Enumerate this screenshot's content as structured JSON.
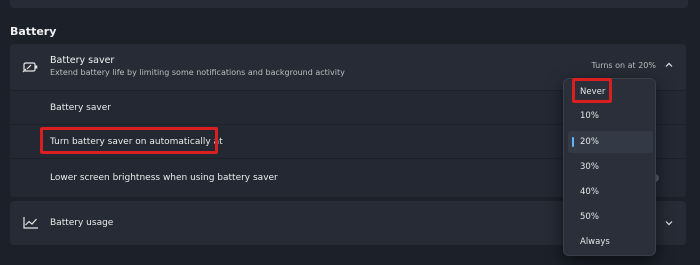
{
  "section": {
    "title": "Battery"
  },
  "battery_saver": {
    "title": "Battery saver",
    "subtitle": "Extend battery life by limiting some notifications and background activity",
    "status": "Turns on at 20%"
  },
  "rows": {
    "battery_saver_label": "Battery saver",
    "auto_on_label": "Turn battery saver on automatically at",
    "brightness_label": "Lower screen brightness when using battery saver"
  },
  "battery_usage": {
    "label": "Battery usage"
  },
  "dropdown": {
    "options": [
      "Never",
      "10%",
      "20%",
      "30%",
      "40%",
      "50%",
      "Always"
    ],
    "selected": "20%"
  },
  "colors": {
    "highlight": "#d91f1f",
    "accent": "#62b5ff"
  },
  "icons": [
    "battery-saver-icon",
    "chevron-up-icon",
    "chevron-down-icon",
    "chart-icon"
  ]
}
